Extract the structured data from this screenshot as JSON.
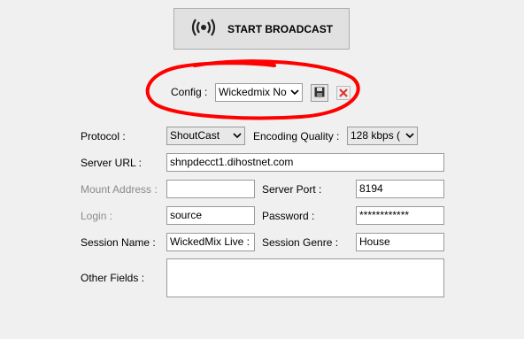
{
  "broadcast": {
    "label": "START BROADCAST",
    "icon": "broadcast-icon"
  },
  "config": {
    "label": "Config :",
    "value": "Wickedmix No",
    "save_icon": "save-icon",
    "delete_icon": "delete-icon"
  },
  "annotation": {
    "color": "#ff0000"
  },
  "protocol": {
    "label": "Protocol :",
    "value": "ShoutCast"
  },
  "encoding": {
    "label": "Encoding Quality :",
    "value": "128 kbps ("
  },
  "server_url": {
    "label": "Server URL :",
    "value": "shnpdecct1.dihostnet.com"
  },
  "mount": {
    "label": "Mount Address :",
    "value": ""
  },
  "server_port": {
    "label": "Server Port :",
    "value": "8194"
  },
  "login": {
    "label": "Login :",
    "value": "source"
  },
  "password": {
    "label": "Password :",
    "value": "************"
  },
  "session_name": {
    "label": "Session Name :",
    "value": "WickedMix Live :"
  },
  "session_genre": {
    "label": "Session Genre :",
    "value": "House"
  },
  "other_fields": {
    "label": "Other Fields :",
    "value": ""
  }
}
